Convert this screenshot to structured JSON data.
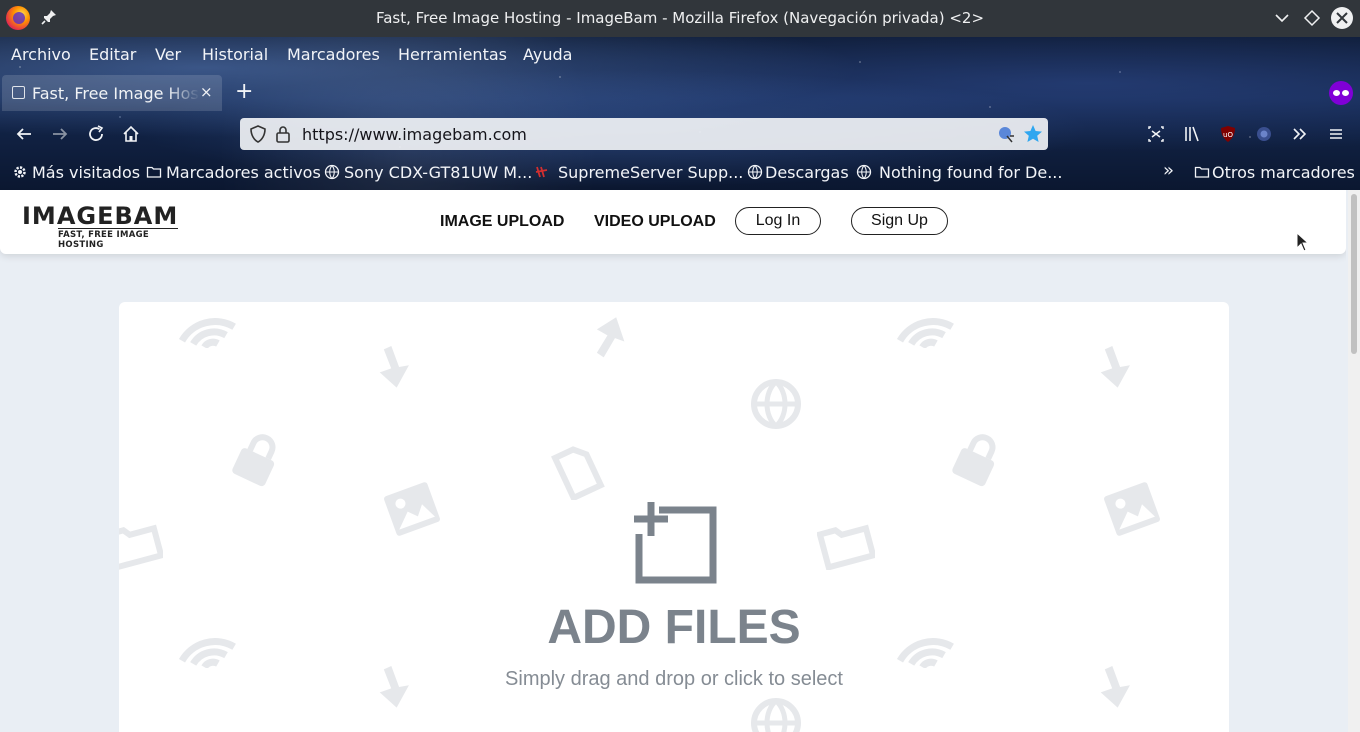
{
  "window": {
    "title": "Fast, Free Image Hosting - ImageBam - Mozilla Firefox (Navegación privada) <2>"
  },
  "menubar": {
    "items": [
      "Archivo",
      "Editar",
      "Ver",
      "Historial",
      "Marcadores",
      "Herramientas",
      "Ayuda"
    ]
  },
  "tabs": [
    {
      "label": "Fast, Free Image Hosting - ImageBam",
      "close": "×"
    }
  ],
  "newtab": "+",
  "navbar": {
    "url": "https://www.imagebam.com"
  },
  "bookmarks": {
    "items": [
      "Más visitados",
      "Marcadores activos",
      "Sony CDX-GT81UW M...",
      "SupremeServer Supp...",
      "Descargas",
      "Nothing found for De..."
    ],
    "overflow": "»",
    "other": "Otros marcadores"
  },
  "site": {
    "logo_main": "IMAGEBAM",
    "logo_sub": "FAST, FREE IMAGE HOSTING",
    "nav": {
      "image_upload": "IMAGE UPLOAD",
      "video_upload": "VIDEO UPLOAD",
      "login": "Log In",
      "signup": "Sign Up"
    }
  },
  "upload": {
    "title": "ADD FILES",
    "subtitle": "Simply drag and drop or click to select"
  },
  "colors": {
    "accent_star": "#2ea6f0",
    "private": "#8000d7",
    "upload_text": "#7b838c"
  }
}
